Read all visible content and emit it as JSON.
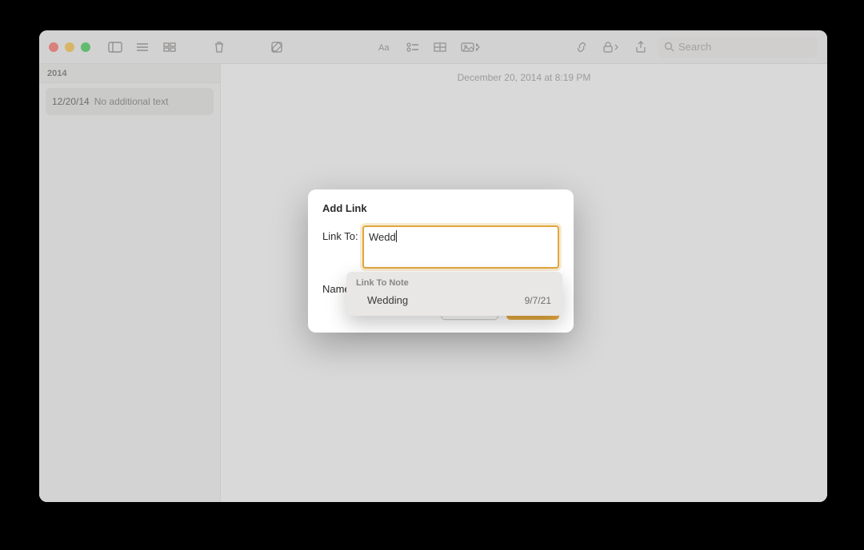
{
  "toolbar": {
    "search_placeholder": "Search"
  },
  "sidebar": {
    "header": "2014",
    "note": {
      "date": "12/20/14",
      "subtitle": "No additional text"
    }
  },
  "editor": {
    "timestamp": "December 20, 2014 at 8:19 PM"
  },
  "modal": {
    "title": "Add Link",
    "link_to_label": "Link To:",
    "link_to_value": "Wedd",
    "name_label": "Name:",
    "cancel": "Cancel",
    "ok": "OK"
  },
  "popover": {
    "header": "Link To Note",
    "item_title": "Wedding",
    "item_date": "9/7/21"
  }
}
